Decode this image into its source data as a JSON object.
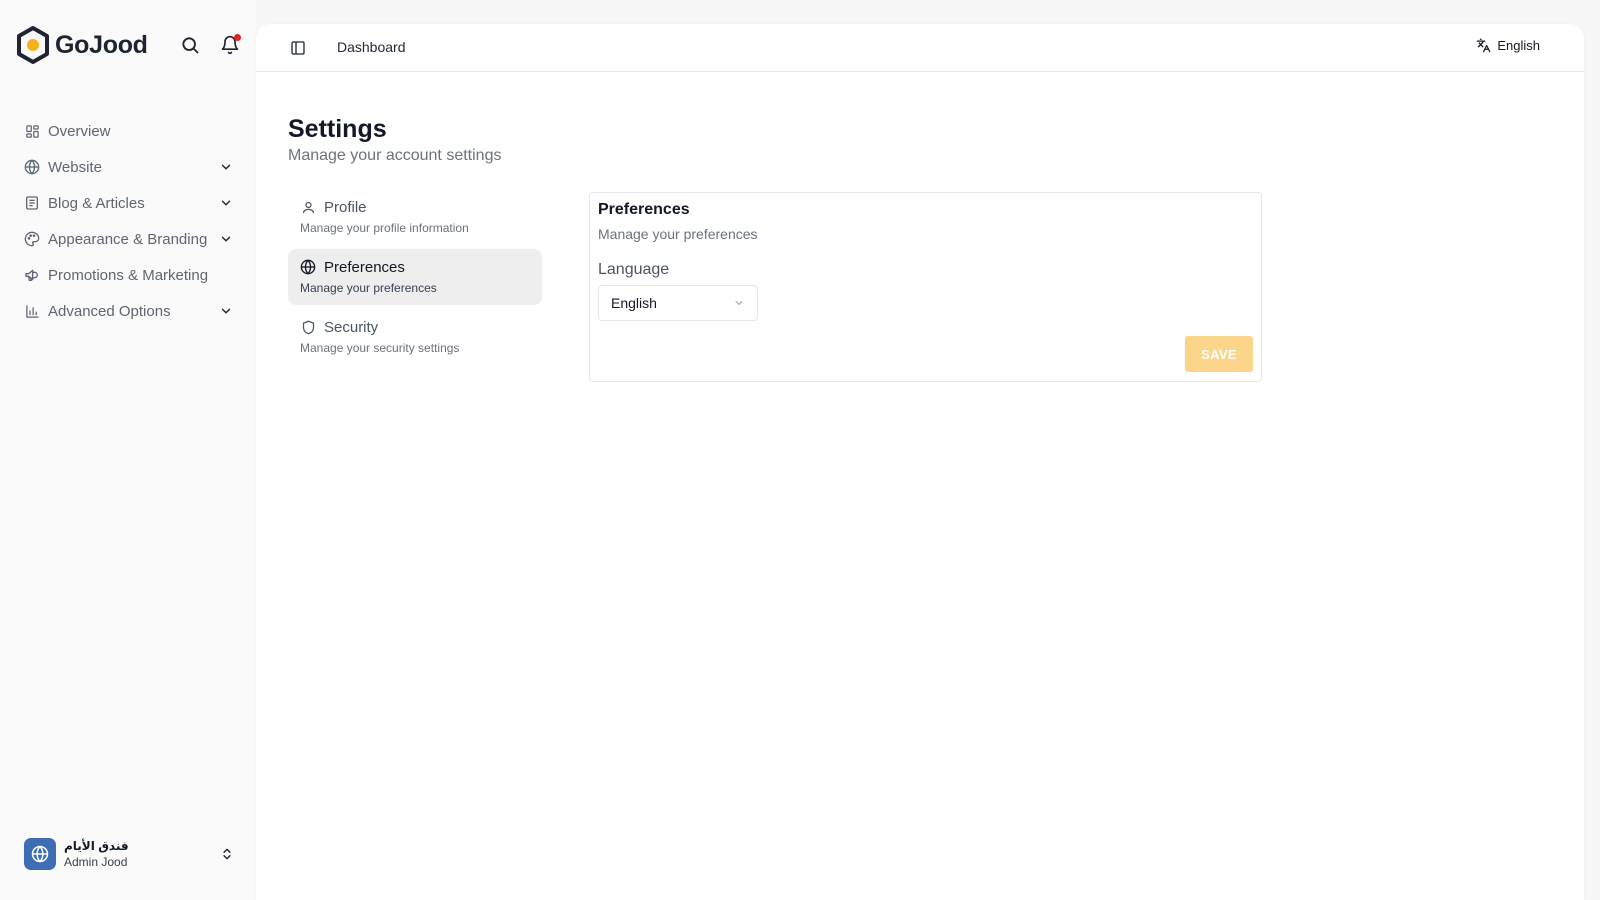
{
  "brand": {
    "name": "GoJood",
    "logo_icon": "hexagon-logo-icon"
  },
  "header_icons": {
    "search": "search-icon",
    "notifications": "bell-icon",
    "notification_dot_color": "#e02424"
  },
  "sidebar": {
    "items": [
      {
        "label": "Overview",
        "icon": "grid-icon",
        "expandable": false
      },
      {
        "label": "Website",
        "icon": "globe-icon",
        "expandable": true
      },
      {
        "label": "Blog & Articles",
        "icon": "newspaper-icon",
        "expandable": true
      },
      {
        "label": "Appearance & Branding",
        "icon": "palette-icon",
        "expandable": true
      },
      {
        "label": "Promotions & Marketing",
        "icon": "megaphone-icon",
        "expandable": false
      },
      {
        "label": "Advanced Options",
        "icon": "bar-chart-icon",
        "expandable": true
      }
    ]
  },
  "user": {
    "org_name": "فندق الأيام",
    "name": "Admin Jood",
    "avatar_icon": "globe-icon",
    "avatar_color": "#3d6db3"
  },
  "topbar": {
    "breadcrumb": "Dashboard",
    "language": "English",
    "language_icon": "translate-icon"
  },
  "page": {
    "title": "Settings",
    "subtitle": "Manage your account settings"
  },
  "settings_nav": {
    "items": [
      {
        "label": "Profile",
        "description": "Manage your profile information",
        "icon": "user-icon",
        "active": false
      },
      {
        "label": "Preferences",
        "description": "Manage your preferences",
        "icon": "globe-icon",
        "active": true
      },
      {
        "label": "Security",
        "description": "Manage your security settings",
        "icon": "shield-icon",
        "active": false
      }
    ]
  },
  "preferences_card": {
    "title": "Preferences",
    "subtitle": "Manage your preferences",
    "language_label": "Language",
    "language_value": "English",
    "save_label": "SAVE",
    "save_color": "#fbd58a"
  }
}
